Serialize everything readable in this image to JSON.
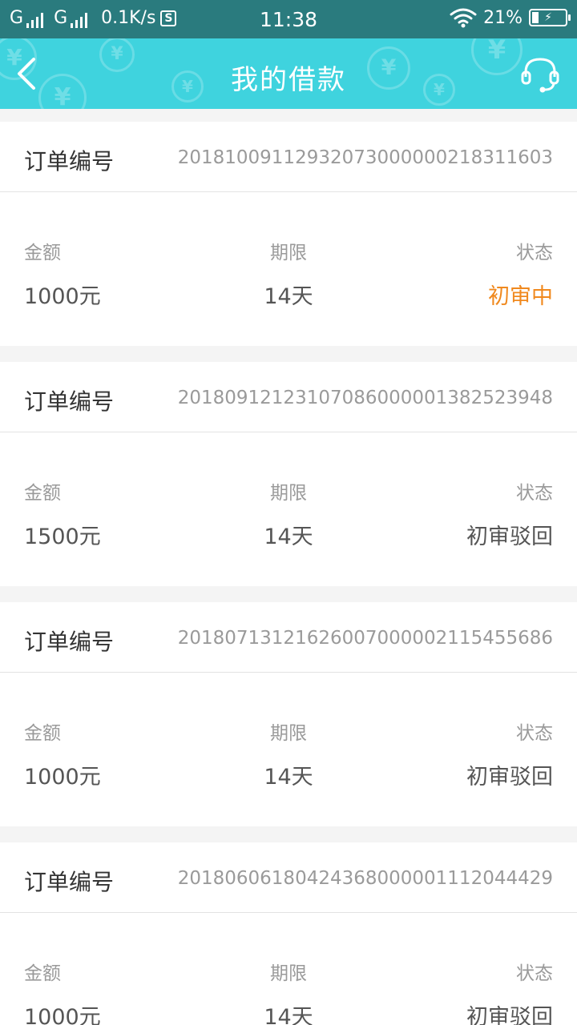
{
  "status_bar": {
    "sim1": "G",
    "sim2": "G",
    "net_speed": "0.1K/s",
    "s_badge": "S",
    "time": "11:38",
    "battery_percent": "21%",
    "battery_level": 0.21,
    "icons": [
      "signal-icon",
      "wifi-icon",
      "battery-icon"
    ]
  },
  "header": {
    "title": "我的借款",
    "back_icon": "chevron-left-icon",
    "service_icon": "headset-icon",
    "background_color": "#3fd3de",
    "coin_glyph": "¥"
  },
  "orders": [
    {
      "order_label": "订单编号",
      "order_no": "20181009112932073000000218311603",
      "amount_label": "金额",
      "amount": "1000元",
      "term_label": "期限",
      "term": "14天",
      "status_label": "状态",
      "status": "初审中",
      "status_color": "#f0891e"
    },
    {
      "order_label": "订单编号",
      "order_no": "20180912123107086000001382523948",
      "amount_label": "金额",
      "amount": "1500元",
      "term_label": "期限",
      "term": "14天",
      "status_label": "状态",
      "status": "初审驳回",
      "status_color": "#555555"
    },
    {
      "order_label": "订单编号",
      "order_no": "20180713121626007000002115455686",
      "amount_label": "金额",
      "amount": "1000元",
      "term_label": "期限",
      "term": "14天",
      "status_label": "状态",
      "status": "初审驳回",
      "status_color": "#555555"
    },
    {
      "order_label": "订单编号",
      "order_no": "20180606180424368000001112044429",
      "amount_label": "金额",
      "amount": "1000元",
      "term_label": "期限",
      "term": "14天",
      "status_label": "状态",
      "status": "初审驳回",
      "status_color": "#555555"
    }
  ]
}
